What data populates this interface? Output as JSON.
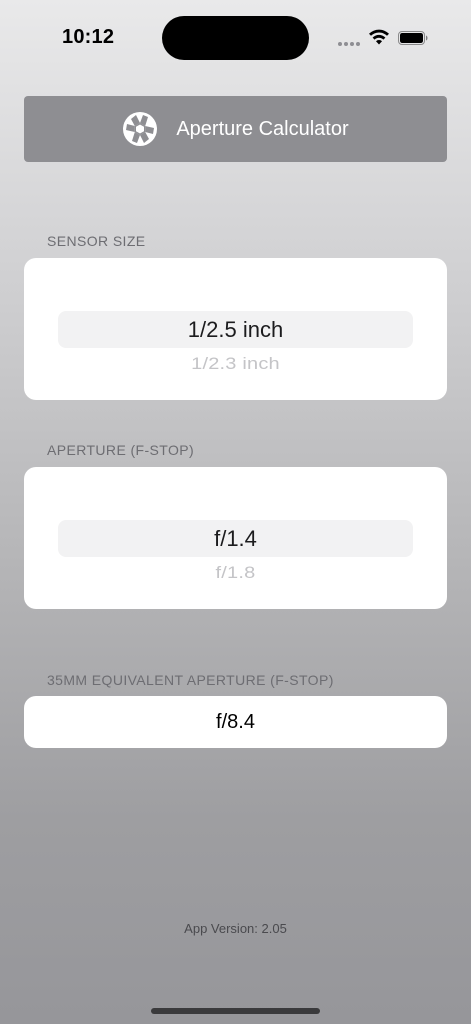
{
  "status_bar": {
    "time": "10:12",
    "icons": [
      "cellular-signal-icon",
      "wifi-icon",
      "battery-icon"
    ]
  },
  "header": {
    "title": "Aperture Calculator",
    "icon": "aperture-icon",
    "background_color": "#8e8e92"
  },
  "sensor_size": {
    "label": "SENSOR SIZE",
    "selected": "1/2.5 inch",
    "next": "1/2.3 inch"
  },
  "aperture": {
    "label": "APERTURE (F-STOP)",
    "selected": "f/1.4",
    "next": "f/1.8"
  },
  "equivalent": {
    "label": "35MM EQUIVALENT APERTURE (F-STOP)",
    "value": "f/8.4"
  },
  "footer": {
    "version": "App Version: 2.05"
  }
}
